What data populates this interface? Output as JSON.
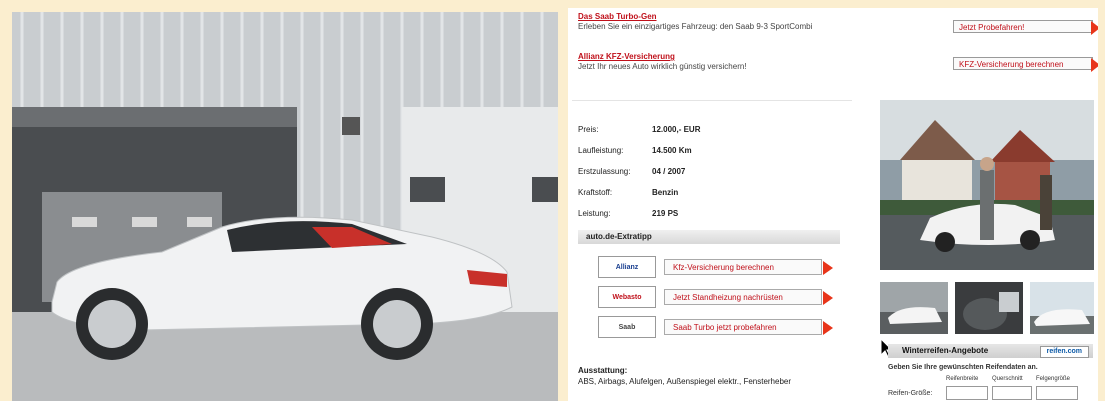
{
  "promos": [
    {
      "title": "Das Saab Turbo-Gen",
      "desc": "Erleben Sie ein einzigartiges Fahrzeug: den Saab 9-3 SportCombi",
      "cta": "Jetzt Probefahren!"
    },
    {
      "title": "Allianz KFZ-Versicherung",
      "desc": "Jetzt Ihr neues Auto wirklich günstig versichern!",
      "cta": "KFZ-Versicherung berechnen"
    }
  ],
  "specs": [
    {
      "label": "Preis:",
      "value": "12.000,- EUR"
    },
    {
      "label": "Laufleistung:",
      "value": "14.500 Km"
    },
    {
      "label": "Erstzulassung:",
      "value": "04 / 2007"
    },
    {
      "label": "Kraftstoff:",
      "value": "Benzin"
    },
    {
      "label": "Leistung:",
      "value": "219 PS"
    }
  ],
  "extratipp": {
    "title": "auto.de-Extratipp",
    "items": [
      {
        "logo": "Allianz",
        "label": "Kfz-Versicherung berechnen"
      },
      {
        "logo": "Webasto",
        "label": "Jetzt Standheizung nachrüsten"
      },
      {
        "logo": "Saab",
        "label": "Saab Turbo jetzt probefahren"
      }
    ]
  },
  "ausstattung": {
    "title": "Ausstattung:",
    "text": "ABS, Airbags, Alufelgen, Außenspiegel elektr., Fensterheber"
  },
  "tires": {
    "title": "Winterreifen-Angebote",
    "brand": "reifen.com",
    "prompt": "Geben Sie Ihre gewünschten Reifendaten an.",
    "size_label": "Reifen-Größe:",
    "cols": [
      "Reifenbreite",
      "Querschnitt",
      "Felgengröße"
    ]
  },
  "colors": {
    "accent": "#c0101a",
    "arrow": "#e8351a",
    "page_bg": "#fbeecf"
  }
}
